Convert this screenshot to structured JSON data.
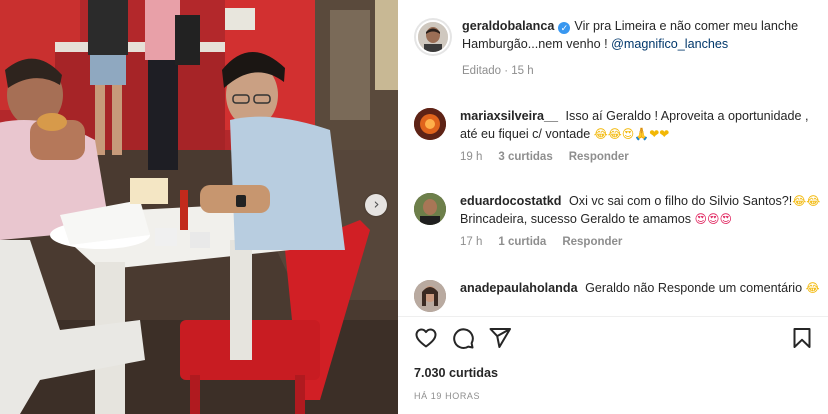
{
  "post": {
    "author": "geraldobalanca",
    "caption": "Vir pra Limeira e não comer meu lanche Hamburgão...nem venho !",
    "mention": "@magnifico_lanches",
    "edited": "Editado",
    "time": "15 h"
  },
  "comments": [
    {
      "user": "mariaxsilveira__",
      "text": "Isso aí Geraldo ! Aproveita a oportunidade , até eu fiquei c/ vontade",
      "emojis": "😂😂😍🙏❤❤",
      "time": "19 h",
      "likes": "3 curtidas",
      "reply": "Responder"
    },
    {
      "user": "eduardocostatkd",
      "text": "Oxi vc sai com o filho do Silvio Santos?!",
      "emojis_mid": "😂😂",
      "text2": "Brincadeira, sucesso Geraldo te amamos",
      "emojis": "😍😍😍",
      "time": "17 h",
      "likes": "1 curtida",
      "reply": "Responder"
    },
    {
      "user": "anadepaulaholanda",
      "text": "Geraldo não Responde um comentário",
      "emojis": "😂"
    }
  ],
  "likes_count": "7.030 curtidas",
  "time_ago": "HÁ 19 HORAS",
  "icons": [
    "heart-icon",
    "comment-icon",
    "share-icon",
    "bookmark-icon",
    "chevron-right-icon",
    "verified-icon"
  ],
  "colors": {
    "verified": "#3897f0",
    "mention": "#00376b",
    "muted": "#8e8e8e"
  },
  "photo": {
    "next_glyph": "›"
  }
}
